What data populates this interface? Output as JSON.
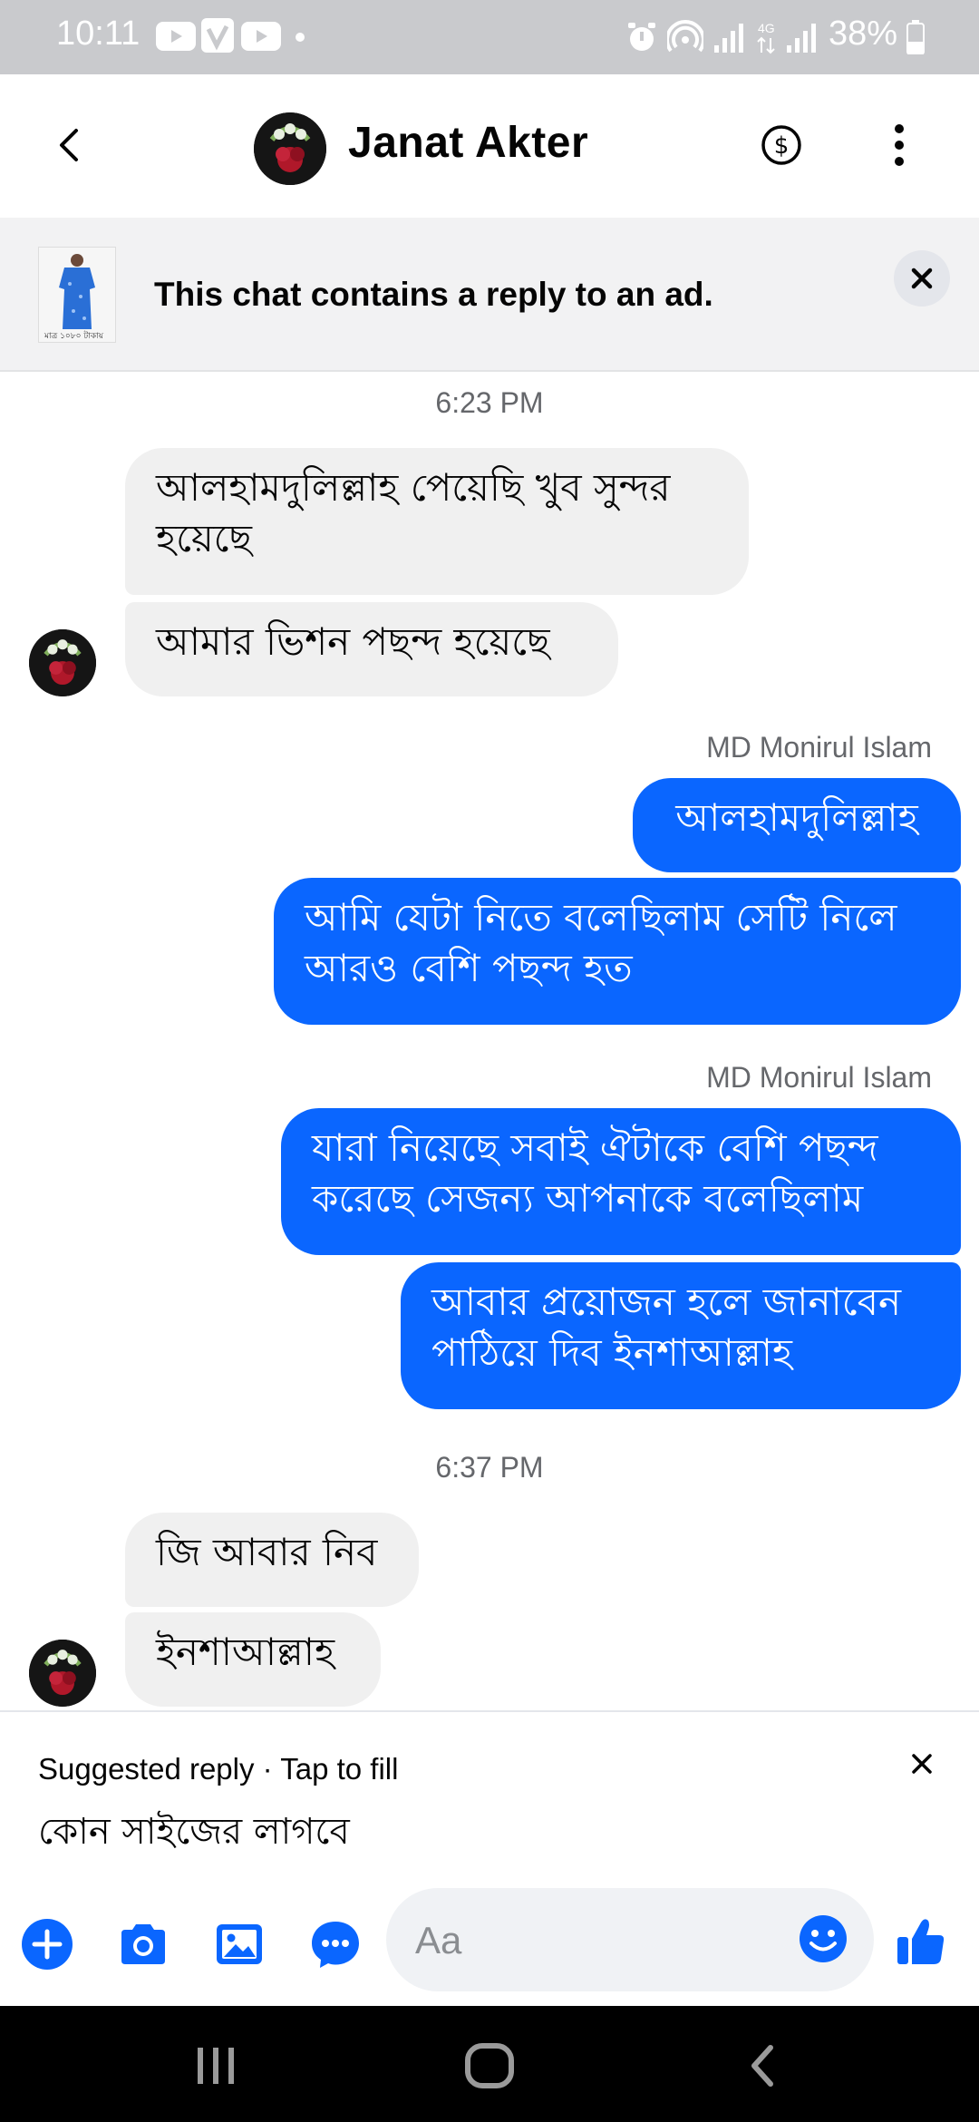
{
  "status_bar": {
    "time": "10:11",
    "battery": "38%"
  },
  "header": {
    "contact_name": "Janat Akter"
  },
  "ad_banner": {
    "text": "This chat contains a reply to an ad.",
    "thumb_caption": "মাত্র ১০৮০ টাকায়"
  },
  "messages": {
    "time_1": "6:23 PM",
    "in_1": "আলহামদুলিল্লাহ পেয়েছি খুব সুন্দর হয়েছে",
    "in_2": "আমার ভিশন পছন্দ হয়েছে",
    "sender_1": "MD Monirul Islam",
    "out_1": "আলহামদুলিল্লাহ",
    "out_2": "আমি যেটা নিতে বলেছিলাম সেটি নিলে আরও বেশি পছন্দ হত",
    "sender_2": "MD Monirul Islam",
    "out_3": "যারা নিয়েছে সবাই ঐটাকে বেশি পছন্দ করেছে সেজন্য আপনাকে বলেছিলাম",
    "out_4": "আবার প্রয়োজন হলে জানাবেন পাঠিয়ে দিব ইনশাআল্লাহ",
    "time_2": "6:37 PM",
    "in_3": "জি আবার নিব",
    "in_4": "ইনশাআল্লাহ"
  },
  "suggested_reply": {
    "label": "Suggested reply · Tap to fill",
    "text": "কোন সাইজের লাগবে"
  },
  "composer": {
    "placeholder": "Aa"
  },
  "colors": {
    "accent": "#0a66ff",
    "incoming_bubble": "#f0f0f0",
    "status_bar": "#c9cacd"
  },
  "icons": [
    "back-arrow-icon",
    "payment-icon",
    "more-icon",
    "close-icon",
    "plus-icon",
    "camera-icon",
    "gallery-icon",
    "chat-bubble-icon",
    "emoji-icon",
    "like-icon",
    "recents-icon",
    "home-icon",
    "nav-back-icon"
  ]
}
